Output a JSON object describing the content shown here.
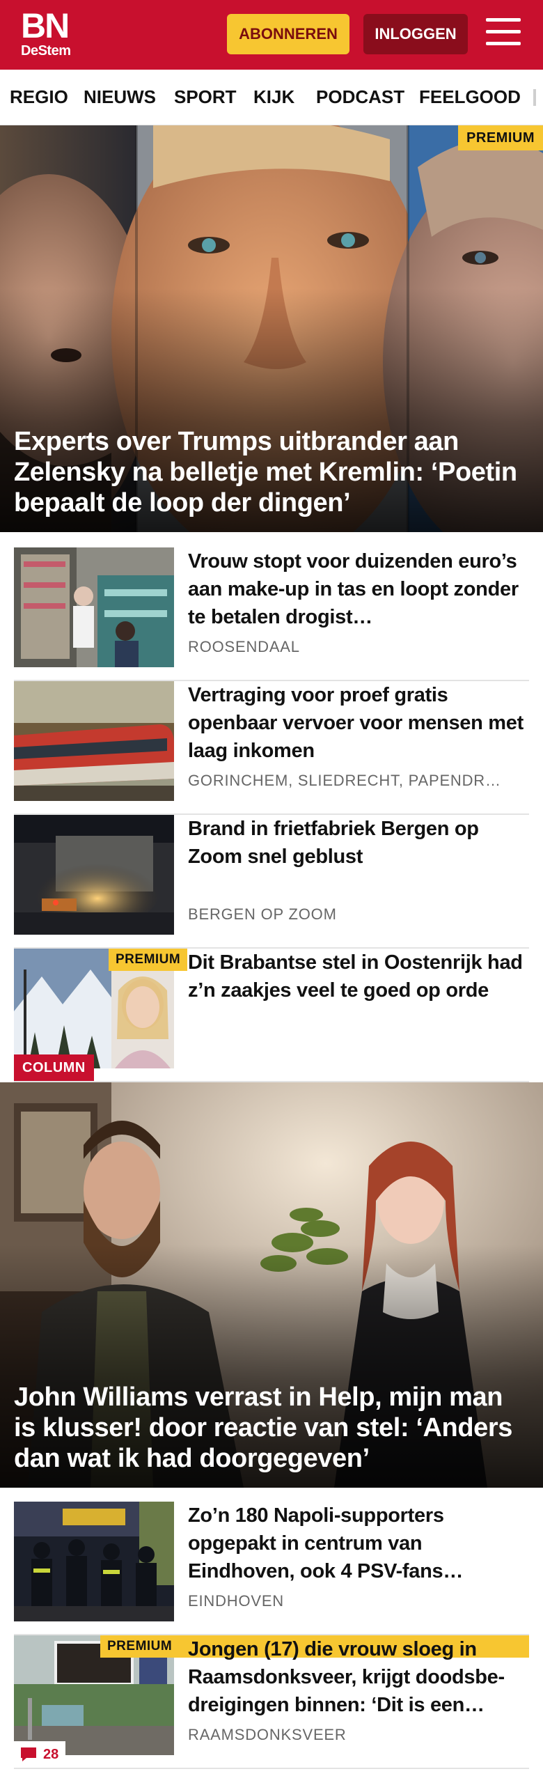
{
  "header": {
    "logo_main": "BN",
    "logo_sub": "DeStem",
    "subscribe_label": "ABONNEREN",
    "login_label": "INLOGGEN",
    "menu_icon": "hamburger-menu-icon"
  },
  "nav": {
    "items": [
      "REGIO",
      "NIEUWS",
      "SPORT",
      "KIJK",
      "PODCAST",
      "FEELGOOD"
    ]
  },
  "hero_top": {
    "badge": "PREMIUM",
    "headline": "Experts over Trumps uitbrander aan Zelensky na belletje met Kremlin: ‘Poetin bepaalt de loop der dingen’"
  },
  "articles": [
    {
      "title": "Vrouw stopt voor duizenden euro’s aan make-up in tas en loopt zonder te betalen drogist…",
      "location": "ROOSENDAAL"
    },
    {
      "title": "Vertraging voor proef gratis openbaar vervoer voor mensen met laag inkomen",
      "location": "GORINCHEM, SLIEDRECHT, PAPENDR…"
    },
    {
      "title": "Brand in frietfabriek Bergen op Zoom snel geblust",
      "location": "BERGEN OP ZOOM"
    },
    {
      "title": "Dit Brabantse stel in Oostenrijk had z’n zaakjes veel te goed op orde",
      "location": "",
      "premium": "PREMIUM",
      "column": "COLUMN"
    }
  ],
  "hero_video": {
    "headline": "John Williams verrast in Help, mijn man is klusser! door reactie van stel: ‘Anders dan wat ik had doorgegeven’"
  },
  "articles2": [
    {
      "title": "Zo’n 180 Napoli-supporters opgepakt in centrum van Eindhoven, ook 4 PSV-fans…",
      "location": "EINDHOVEN"
    },
    {
      "title": "Jongen (17) die vrouw sloeg in Raamsdonksveer, krijgt doodsbe­dreigingen binnen: ‘Dit is een…",
      "location": "RAAMSDONKSVEER",
      "premium": "PREMIUM",
      "comments": "28"
    }
  ],
  "colors": {
    "brand_red": "#c8102e",
    "premium_yellow": "#f7c631",
    "login_dark_red": "#8a0d1c"
  }
}
